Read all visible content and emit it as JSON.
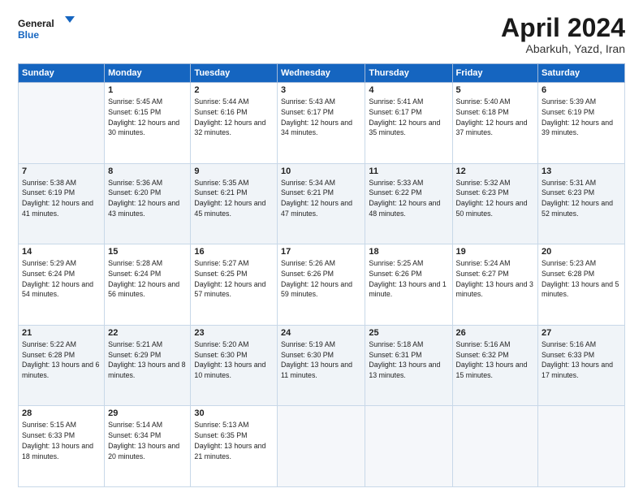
{
  "header": {
    "logo_line1": "General",
    "logo_line2": "Blue",
    "month": "April 2024",
    "location": "Abarkuh, Yazd, Iran"
  },
  "weekdays": [
    "Sunday",
    "Monday",
    "Tuesday",
    "Wednesday",
    "Thursday",
    "Friday",
    "Saturday"
  ],
  "weeks": [
    [
      {
        "day": null
      },
      {
        "day": 1,
        "sunrise": "5:45 AM",
        "sunset": "6:15 PM",
        "daylight": "12 hours and 30 minutes."
      },
      {
        "day": 2,
        "sunrise": "5:44 AM",
        "sunset": "6:16 PM",
        "daylight": "12 hours and 32 minutes."
      },
      {
        "day": 3,
        "sunrise": "5:43 AM",
        "sunset": "6:17 PM",
        "daylight": "12 hours and 34 minutes."
      },
      {
        "day": 4,
        "sunrise": "5:41 AM",
        "sunset": "6:17 PM",
        "daylight": "12 hours and 35 minutes."
      },
      {
        "day": 5,
        "sunrise": "5:40 AM",
        "sunset": "6:18 PM",
        "daylight": "12 hours and 37 minutes."
      },
      {
        "day": 6,
        "sunrise": "5:39 AM",
        "sunset": "6:19 PM",
        "daylight": "12 hours and 39 minutes."
      }
    ],
    [
      {
        "day": 7,
        "sunrise": "5:38 AM",
        "sunset": "6:19 PM",
        "daylight": "12 hours and 41 minutes."
      },
      {
        "day": 8,
        "sunrise": "5:36 AM",
        "sunset": "6:20 PM",
        "daylight": "12 hours and 43 minutes."
      },
      {
        "day": 9,
        "sunrise": "5:35 AM",
        "sunset": "6:21 PM",
        "daylight": "12 hours and 45 minutes."
      },
      {
        "day": 10,
        "sunrise": "5:34 AM",
        "sunset": "6:21 PM",
        "daylight": "12 hours and 47 minutes."
      },
      {
        "day": 11,
        "sunrise": "5:33 AM",
        "sunset": "6:22 PM",
        "daylight": "12 hours and 48 minutes."
      },
      {
        "day": 12,
        "sunrise": "5:32 AM",
        "sunset": "6:23 PM",
        "daylight": "12 hours and 50 minutes."
      },
      {
        "day": 13,
        "sunrise": "5:31 AM",
        "sunset": "6:23 PM",
        "daylight": "12 hours and 52 minutes."
      }
    ],
    [
      {
        "day": 14,
        "sunrise": "5:29 AM",
        "sunset": "6:24 PM",
        "daylight": "12 hours and 54 minutes."
      },
      {
        "day": 15,
        "sunrise": "5:28 AM",
        "sunset": "6:24 PM",
        "daylight": "12 hours and 56 minutes."
      },
      {
        "day": 16,
        "sunrise": "5:27 AM",
        "sunset": "6:25 PM",
        "daylight": "12 hours and 57 minutes."
      },
      {
        "day": 17,
        "sunrise": "5:26 AM",
        "sunset": "6:26 PM",
        "daylight": "12 hours and 59 minutes."
      },
      {
        "day": 18,
        "sunrise": "5:25 AM",
        "sunset": "6:26 PM",
        "daylight": "13 hours and 1 minute."
      },
      {
        "day": 19,
        "sunrise": "5:24 AM",
        "sunset": "6:27 PM",
        "daylight": "13 hours and 3 minutes."
      },
      {
        "day": 20,
        "sunrise": "5:23 AM",
        "sunset": "6:28 PM",
        "daylight": "13 hours and 5 minutes."
      }
    ],
    [
      {
        "day": 21,
        "sunrise": "5:22 AM",
        "sunset": "6:28 PM",
        "daylight": "13 hours and 6 minutes."
      },
      {
        "day": 22,
        "sunrise": "5:21 AM",
        "sunset": "6:29 PM",
        "daylight": "13 hours and 8 minutes."
      },
      {
        "day": 23,
        "sunrise": "5:20 AM",
        "sunset": "6:30 PM",
        "daylight": "13 hours and 10 minutes."
      },
      {
        "day": 24,
        "sunrise": "5:19 AM",
        "sunset": "6:30 PM",
        "daylight": "13 hours and 11 minutes."
      },
      {
        "day": 25,
        "sunrise": "5:18 AM",
        "sunset": "6:31 PM",
        "daylight": "13 hours and 13 minutes."
      },
      {
        "day": 26,
        "sunrise": "5:16 AM",
        "sunset": "6:32 PM",
        "daylight": "13 hours and 15 minutes."
      },
      {
        "day": 27,
        "sunrise": "5:16 AM",
        "sunset": "6:33 PM",
        "daylight": "13 hours and 17 minutes."
      }
    ],
    [
      {
        "day": 28,
        "sunrise": "5:15 AM",
        "sunset": "6:33 PM",
        "daylight": "13 hours and 18 minutes."
      },
      {
        "day": 29,
        "sunrise": "5:14 AM",
        "sunset": "6:34 PM",
        "daylight": "13 hours and 20 minutes."
      },
      {
        "day": 30,
        "sunrise": "5:13 AM",
        "sunset": "6:35 PM",
        "daylight": "13 hours and 21 minutes."
      },
      {
        "day": null
      },
      {
        "day": null
      },
      {
        "day": null
      },
      {
        "day": null
      }
    ]
  ]
}
